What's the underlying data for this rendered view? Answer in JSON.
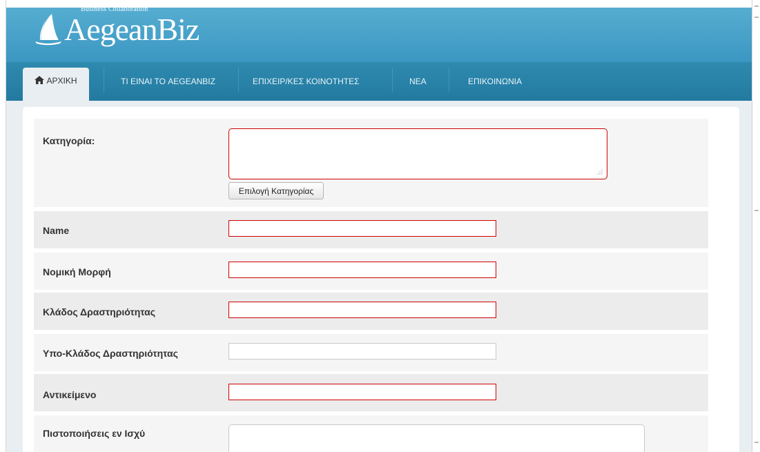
{
  "header": {
    "logo_text": "AegeanBiz",
    "logo_tagline": "Business Collaboration"
  },
  "nav": {
    "items": [
      {
        "label": "ΑΡΧΙΚΗ"
      },
      {
        "label": "ΤΙ ΕΙΝΑΙ ΤΟ AEGEANBIZ"
      },
      {
        "label": "ΕΠΙΧΕΙΡ/ΚΕΣ ΚΟΙΝΟΤΗΤΕΣ"
      },
      {
        "label": "ΝΕΑ"
      },
      {
        "label": "ΕΠΙΚΟΙΝΩΝΙΑ"
      }
    ]
  },
  "form": {
    "category": {
      "label": "Κατηγορία:",
      "value": "",
      "button": "Επιλογή Κατηγορίας"
    },
    "name": {
      "label": "Name",
      "value": ""
    },
    "legal_form": {
      "label": "Νομική Μορφή",
      "value": ""
    },
    "activity_sector": {
      "label": "Κλάδος Δραστηριότητας",
      "value": ""
    },
    "activity_subsector": {
      "label": "Υπο-Κλάδος Δραστηριότητας",
      "value": ""
    },
    "subject": {
      "label": "Αντικείμενο",
      "value": ""
    },
    "certifications": {
      "label": "Πιστοποιήσεις εν Ισχύ",
      "value": ""
    }
  },
  "colors": {
    "header_blue": "#3b97c2",
    "nav_blue": "#237aa0",
    "required_border": "#cc0000",
    "page_bg": "#e9eef2"
  }
}
